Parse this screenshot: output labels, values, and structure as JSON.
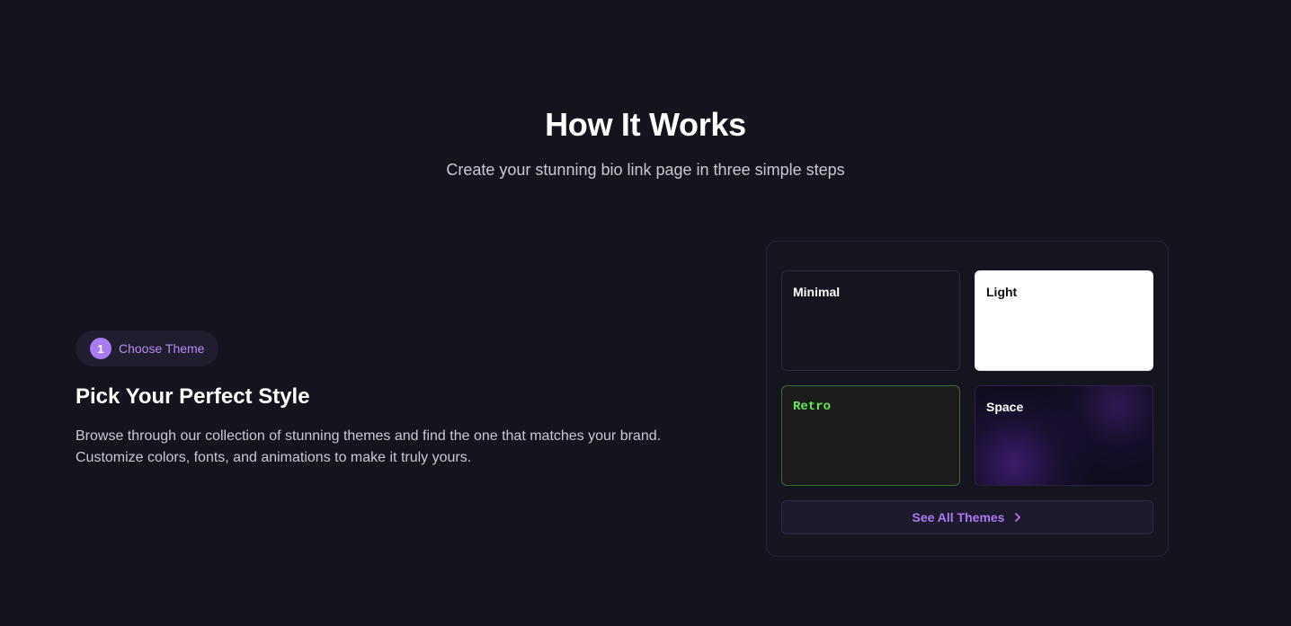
{
  "section": {
    "title": "How It Works",
    "subtitle": "Create your stunning bio link page in three simple steps"
  },
  "step": {
    "number": "1",
    "label": "Choose Theme",
    "title": "Pick Your Perfect Style",
    "description_lines": [
      "Browse through our collection of stunning themes and find the one that matches your brand.",
      "Customize colors, fonts, and animations to make it truly yours."
    ]
  },
  "themes": [
    {
      "name": "Minimal"
    },
    {
      "name": "Light"
    },
    {
      "name": "Retro"
    },
    {
      "name": "Space"
    }
  ],
  "see_all": {
    "label": "See All Themes",
    "icon": "chevron-right-icon"
  },
  "colors": {
    "background": "#14141f",
    "accent": "#a97af0",
    "retro_text": "#62ec55"
  }
}
